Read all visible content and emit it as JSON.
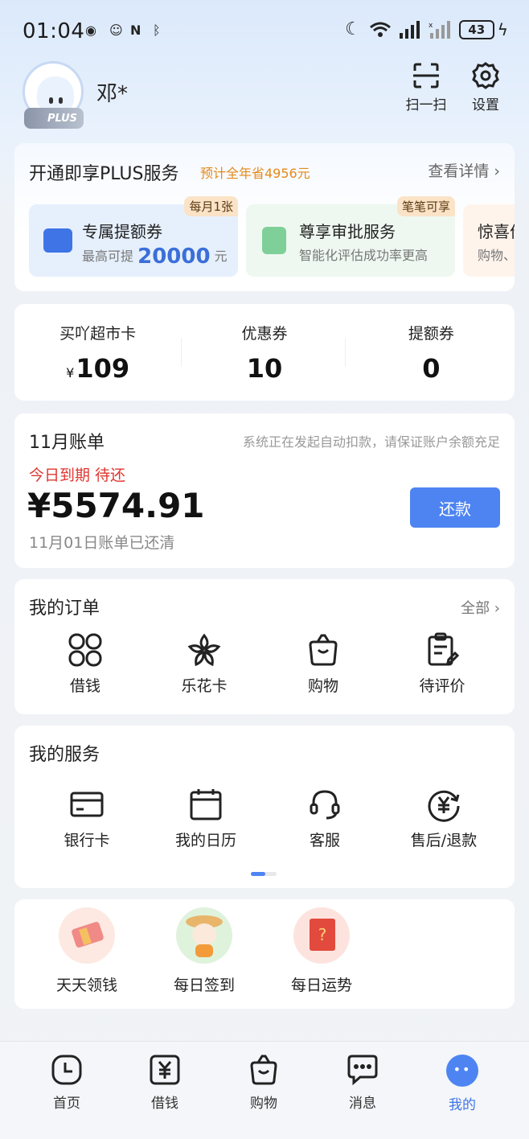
{
  "status_bar": {
    "time": "01:04",
    "battery": "43"
  },
  "header": {
    "plus_badge": "PLUS",
    "username": "邓*",
    "scan_label": "扫一扫",
    "settings_label": "设置"
  },
  "plus_card": {
    "title": "开通即享PLUS服务",
    "saving": "预计全年省4956元",
    "more": "查看详情 ›",
    "items": [
      {
        "badge": "每月1张",
        "title": "专属提额券",
        "sub_prefix": "最高可提",
        "sub_num": "20000",
        "sub_suffix": "元"
      },
      {
        "badge": "笔笔可享",
        "title": "尊享审批服务",
        "sub": "智能化评估成功率更高"
      },
      {
        "title": "惊喜价",
        "sub": "购物、"
      }
    ]
  },
  "stats": [
    {
      "label": "买吖超市卡",
      "currency": "¥",
      "value": "109"
    },
    {
      "label": "优惠券",
      "value": "10"
    },
    {
      "label": "提额券",
      "value": "0"
    }
  ],
  "bill": {
    "title": "11月账单",
    "notice": "系统正在发起自动扣款，请保证账户余额充足",
    "due": "今日到期 待还",
    "amount": "¥5574.91",
    "cleared": "11月01日账单已还清",
    "repay_label": "还款"
  },
  "orders": {
    "title": "我的订单",
    "more": "全部 ›",
    "items": [
      "借钱",
      "乐花卡",
      "购物",
      "待评价"
    ]
  },
  "services": {
    "title": "我的服务",
    "items": [
      "银行卡",
      "我的日历",
      "客服",
      "售后/退款"
    ]
  },
  "fun": {
    "items": [
      "天天领钱",
      "每日签到",
      "每日运势"
    ]
  },
  "tabbar": {
    "items": [
      "首页",
      "借钱",
      "购物",
      "消息",
      "我的"
    ],
    "active_color": "#3e74e6"
  }
}
